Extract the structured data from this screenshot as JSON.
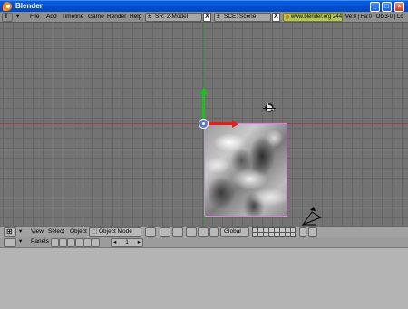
{
  "window": {
    "title": "Blender"
  },
  "menu": {
    "items": [
      "File",
      "Add",
      "Timeline",
      "Game",
      "Render",
      "Help"
    ]
  },
  "screen_field": {
    "prefix": "SR:",
    "value": "2-Model"
  },
  "scene_field": {
    "prefix": "SCE:",
    "value": "Scene"
  },
  "url": "www.blender.org 244",
  "stats": "Ve:0 | Fa:0 | Ob:3-0 | Lc",
  "view_header": {
    "menus": [
      "View",
      "Select",
      "Object"
    ],
    "mode": "Object Mode",
    "orientation": "Global"
  },
  "buttons_header": {
    "label": "Panels",
    "page": "1"
  },
  "colors": {
    "titlebar": "#0651d6",
    "viewport_bg": "#737373",
    "selection": "#e27ee0",
    "axis_y": "#19c419",
    "axis_x": "#e02020"
  }
}
